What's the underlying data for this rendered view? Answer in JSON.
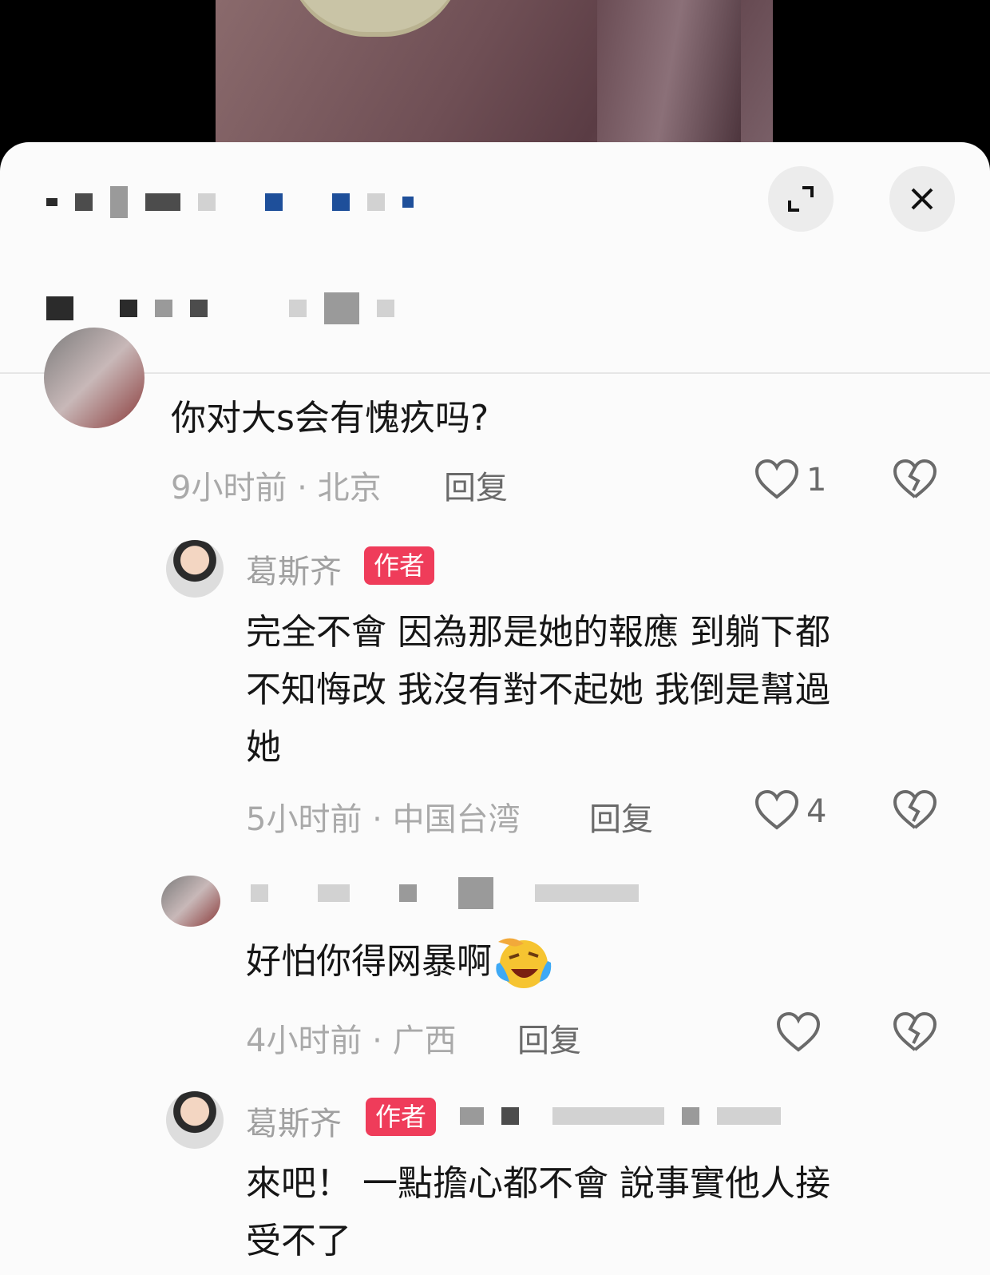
{
  "sheet": {
    "expand_label": "⤢",
    "close_label": "✕"
  },
  "comments": [
    {
      "text": "你对大s会有愧疚吗?",
      "meta": "9小时前 · 北京",
      "reply": "回复",
      "likes": "1"
    },
    {
      "author": "葛斯齐",
      "badge": "作者",
      "text_lines": [
        "完全不會 因為那是她的報應 到躺下都",
        "不知悔改 我沒有對不起她 我倒是幫過",
        "她"
      ],
      "meta": "5小时前 · 中国台湾",
      "reply": "回复",
      "likes": "4"
    },
    {
      "text": "好怕你得网暴啊",
      "emoji": "crying-laughing-face",
      "meta": "4小时前 · 广西",
      "reply": "回复"
    },
    {
      "author": "葛斯齐",
      "badge": "作者",
      "text_lines": [
        "來吧！ 一點擔心都不會 說事實他人接",
        "受不了"
      ]
    }
  ]
}
